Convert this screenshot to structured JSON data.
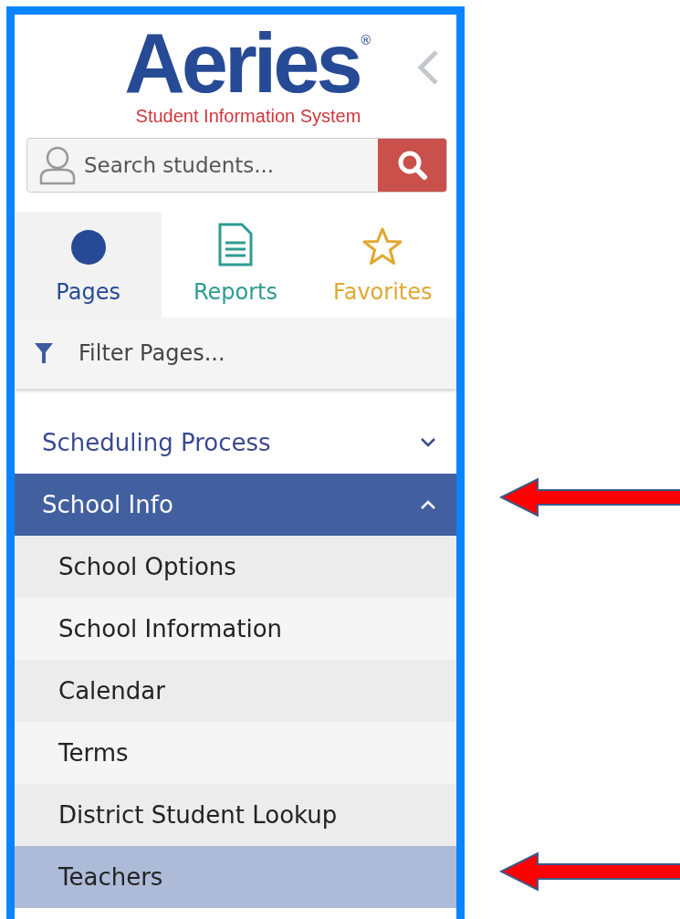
{
  "logo": {
    "title": "Aeries",
    "registered": "®",
    "subtitle": "Student Information System"
  },
  "search": {
    "placeholder": "Search students..."
  },
  "tabs": [
    {
      "label": "Pages",
      "kind": "circle",
      "color": "#264a96",
      "selected": true
    },
    {
      "label": "Reports",
      "kind": "document",
      "color": "#2e9c92",
      "selected": false
    },
    {
      "label": "Favorites",
      "kind": "star",
      "color": "#e0a830",
      "selected": false
    }
  ],
  "filter": {
    "placeholder": "Filter Pages..."
  },
  "menu": [
    {
      "label": "Scheduling Process",
      "expanded": false,
      "selected": false
    },
    {
      "label": "School Info",
      "expanded": true,
      "selected": true,
      "children": [
        {
          "label": "School Options",
          "selected": false
        },
        {
          "label": "School Information",
          "selected": false
        },
        {
          "label": "Calendar",
          "selected": false
        },
        {
          "label": "Terms",
          "selected": false
        },
        {
          "label": "District Student Lookup",
          "selected": false
        },
        {
          "label": "Teachers",
          "selected": true
        }
      ]
    }
  ]
}
